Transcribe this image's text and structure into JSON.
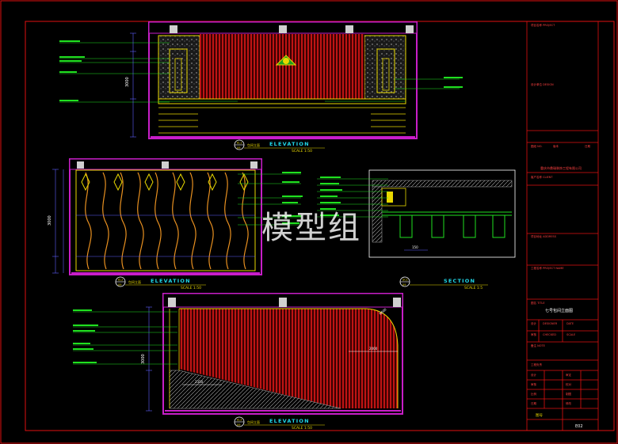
{
  "watermark": "模型组",
  "colors": {
    "frame": "#e01010",
    "wall": "#c81ec8",
    "panel": "#d01818",
    "yellow": "#e8d800",
    "green": "#20e020",
    "cyan": "#20d8e8",
    "white": "#ffffff",
    "dim": "#6060ff"
  },
  "elevations": [
    {
      "id": "E1",
      "callout": "EL1",
      "ref": "09",
      "title": "ELEVATION",
      "scale": "SCALE 1:50"
    },
    {
      "id": "E2",
      "callout": "EL2",
      "ref": "09",
      "title": "ELEVATION",
      "scale": "SCALE 1:50"
    },
    {
      "id": "E3",
      "callout": "EL3",
      "ref": "09",
      "title": "ELEVATION",
      "scale": "SCALE 1:50"
    }
  ],
  "section": {
    "callout": "SC1",
    "ref": "09",
    "title": "SECTION",
    "scale": "SCALE 1:5"
  },
  "dims": {
    "e1_height": "3000",
    "e2_height": "3000",
    "e3_height": "3000",
    "e3_width": "2000",
    "e3_radius": "R600",
    "e3_bottom": "2350",
    "sec_width": "150"
  },
  "title_block": {
    "company": "重庆市鼎瑞装饰工程有限公司",
    "drawing_name": "七号包间立面图",
    "sheet_no": "E02",
    "sheet_label": "图号",
    "version": "修改",
    "scale_label": "比例",
    "date_label": "日期",
    "design_label": "设计",
    "check_label": "审核"
  }
}
